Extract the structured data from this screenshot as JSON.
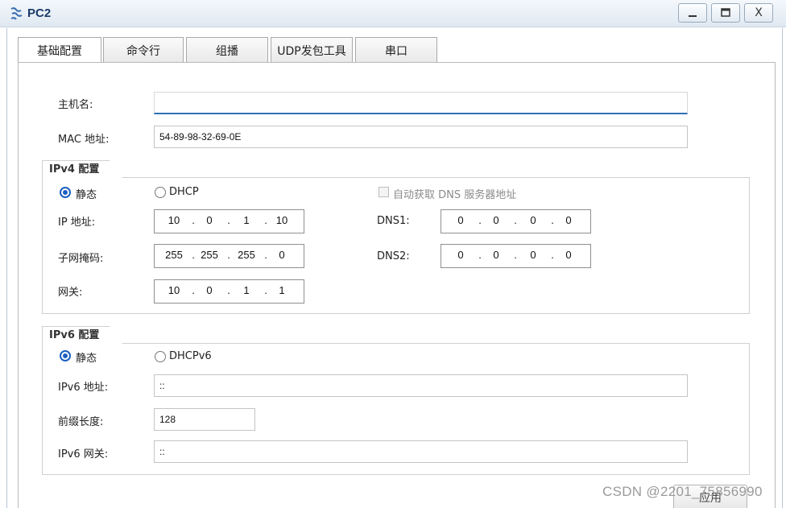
{
  "window": {
    "title": "PC2",
    "minimize_label": "_",
    "maximize_label": "",
    "close_label": "X"
  },
  "tabs": [
    {
      "label": "基础配置"
    },
    {
      "label": "命令行"
    },
    {
      "label": "组播"
    },
    {
      "label": "UDP发包工具"
    },
    {
      "label": "串口"
    }
  ],
  "basic": {
    "hostname_label": "主机名:",
    "hostname_value": "",
    "mac_label": "MAC 地址:",
    "mac_value": "54-89-98-32-69-0E"
  },
  "ipv4": {
    "group_title": "IPv4 配置",
    "static_label": "静态",
    "dhcp_label": "DHCP",
    "auto_dns_label": "自动获取 DNS 服务器地址",
    "ip_label": "IP 地址:",
    "ip": [
      "10",
      "0",
      "1",
      "10"
    ],
    "mask_label": "子网掩码:",
    "mask": [
      "255",
      "255",
      "255",
      "0"
    ],
    "gateway_label": "网关:",
    "gateway": [
      "10",
      "0",
      "1",
      "1"
    ],
    "dns1_label": "DNS1:",
    "dns1": [
      "0",
      "0",
      "0",
      "0"
    ],
    "dns2_label": "DNS2:",
    "dns2": [
      "0",
      "0",
      "0",
      "0"
    ]
  },
  "ipv6": {
    "group_title": "IPv6 配置",
    "static_label": "静态",
    "dhcp_label": "DHCPv6",
    "addr_label": "IPv6 地址:",
    "addr_value": "::",
    "prefix_label": "前缀长度:",
    "prefix_value": "128",
    "gateway_label": "IPv6 网关:",
    "gateway_value": "::"
  },
  "apply_label": "应用",
  "watermark": "CSDN @2201_75856990",
  "colors": {
    "accent": "#1a5fc0",
    "title_text": "#1a3a6a",
    "focus_underline": "#2f6fb5"
  }
}
